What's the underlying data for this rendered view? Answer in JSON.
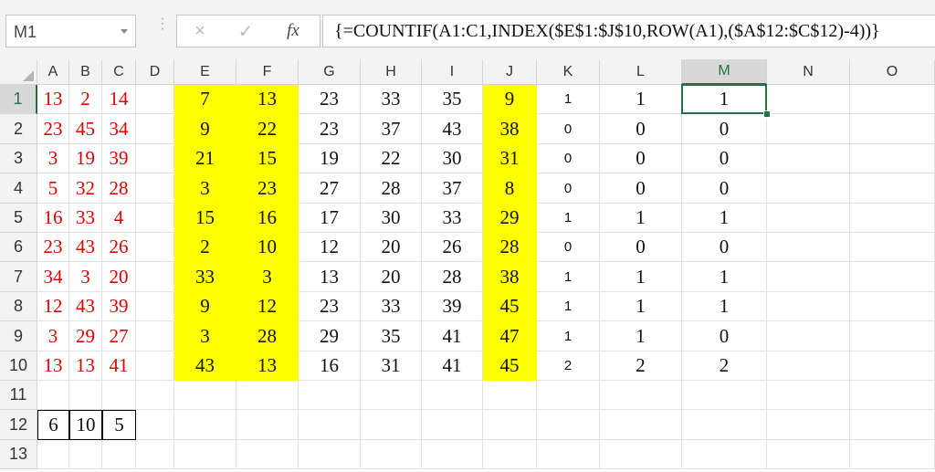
{
  "name_box": "M1",
  "formula_bar": {
    "cancel_icon": "×",
    "enter_icon": "✓",
    "fx_icon": "fx",
    "formula": "{=COUNTIF(A1:C1,INDEX($E$1:$J$10,ROW(A1),($A$12:$C$12)-4))}"
  },
  "columns": [
    "A",
    "B",
    "C",
    "D",
    "E",
    "F",
    "G",
    "H",
    "I",
    "J",
    "K",
    "L",
    "M",
    "N",
    "O"
  ],
  "rows": [
    "1",
    "2",
    "3",
    "4",
    "5",
    "6",
    "7",
    "8",
    "9",
    "10",
    "11",
    "12",
    "13"
  ],
  "selected_column": "M",
  "selected_row": "1",
  "cells": {
    "r1": [
      "13",
      "2",
      "14",
      "",
      "7",
      "13",
      "23",
      "33",
      "35",
      "9",
      "1",
      "1",
      "1",
      "",
      ""
    ],
    "r2": [
      "23",
      "45",
      "34",
      "",
      "9",
      "22",
      "23",
      "37",
      "43",
      "38",
      "0",
      "0",
      "0",
      "",
      ""
    ],
    "r3": [
      "3",
      "19",
      "39",
      "",
      "21",
      "15",
      "19",
      "22",
      "30",
      "31",
      "0",
      "0",
      "0",
      "",
      ""
    ],
    "r4": [
      "5",
      "32",
      "28",
      "",
      "3",
      "23",
      "27",
      "28",
      "37",
      "8",
      "0",
      "0",
      "0",
      "",
      ""
    ],
    "r5": [
      "16",
      "33",
      "4",
      "",
      "15",
      "16",
      "17",
      "30",
      "33",
      "29",
      "1",
      "1",
      "1",
      "",
      ""
    ],
    "r6": [
      "23",
      "43",
      "26",
      "",
      "2",
      "10",
      "12",
      "20",
      "26",
      "28",
      "0",
      "0",
      "0",
      "",
      ""
    ],
    "r7": [
      "34",
      "3",
      "20",
      "",
      "33",
      "3",
      "13",
      "20",
      "28",
      "38",
      "1",
      "1",
      "1",
      "",
      ""
    ],
    "r8": [
      "12",
      "43",
      "39",
      "",
      "9",
      "12",
      "23",
      "33",
      "39",
      "45",
      "1",
      "1",
      "1",
      "",
      ""
    ],
    "r9": [
      "3",
      "29",
      "27",
      "",
      "3",
      "28",
      "29",
      "35",
      "41",
      "47",
      "1",
      "1",
      "0",
      "",
      ""
    ],
    "r10": [
      "13",
      "13",
      "41",
      "",
      "43",
      "13",
      "16",
      "31",
      "41",
      "45",
      "2",
      "2",
      "2",
      "",
      ""
    ],
    "r11": [
      "",
      "",
      "",
      "",
      "",
      "",
      "",
      "",
      "",
      "",
      "",
      "",
      "",
      "",
      ""
    ],
    "r12": [
      "6",
      "10",
      "5",
      "",
      "",
      "",
      "",
      "",
      "",
      "",
      "",
      "",
      "",
      "",
      ""
    ],
    "r13": [
      "",
      "",
      "",
      "",
      "",
      "",
      "",
      "",
      "",
      "",
      "",
      "",
      "",
      "",
      ""
    ]
  },
  "colors": {
    "highlight": "#ffff00",
    "red_text": "#e00000",
    "selection": "#217346"
  }
}
